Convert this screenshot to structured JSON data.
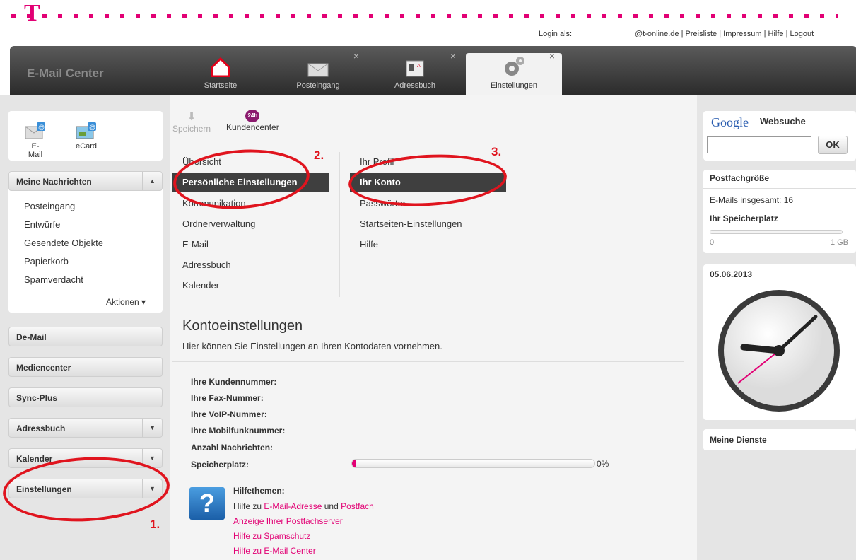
{
  "header": {
    "login_label": "Login als:",
    "account": "@t-online.de",
    "links": [
      "Preisliste",
      "Impressum",
      "Hilfe",
      "Logout"
    ],
    "app_name": "E-Mail Center"
  },
  "tabs": [
    {
      "label": "Startseite"
    },
    {
      "label": "Posteingang",
      "close": "×"
    },
    {
      "label": "Adressbuch",
      "close": "×"
    },
    {
      "label": "Einstellungen",
      "close": "×"
    }
  ],
  "quick": {
    "email": "E-Mail",
    "ecard": "eCard"
  },
  "nachrichten": {
    "title": "Meine Nachrichten",
    "items": [
      "Posteingang",
      "Entwürfe",
      "Gesendete Objekte",
      "Papierkorb",
      "Spamverdacht"
    ],
    "aktionen": "Aktionen"
  },
  "sections": [
    "De-Mail",
    "Mediencenter",
    "Sync-Plus",
    "Adressbuch",
    "Kalender",
    "Einstellungen"
  ],
  "toolbar": {
    "save": "Speichern",
    "kundencenter": "Kundencenter",
    "badge": "24h"
  },
  "menu1": [
    "Übersicht",
    "Persönliche Einstellungen",
    "Kommunikation",
    "Ordnerverwaltung",
    "E-Mail",
    "Adressbuch",
    "Kalender"
  ],
  "menu2": [
    "Ihr Profil",
    "Ihr Konto",
    "Passwörter",
    "Startseiten-Einstellungen",
    "Hilfe"
  ],
  "konto": {
    "title": "Kontoeinstellungen",
    "desc": "Hier können Sie Einstellungen an Ihren Kontodaten vornehmen.",
    "fields": [
      "Ihre Kundennummer:",
      "Ihre Fax-Nummer:",
      "Ihre VoIP-Nummer:",
      "Ihre Mobilfunknummer:",
      "Anzahl Nachrichten:",
      "Speicherplatz:"
    ],
    "storage_pct": "0%",
    "storage_fraction": 0.0
  },
  "help": {
    "title": "Hilfethemen:",
    "line1_prefix": "Hilfe zu ",
    "line1_link1": "E-Mail-Adresse",
    "line1_mid": " und ",
    "line1_link2": "Postfach",
    "links": [
      "Anzeige Ihrer Postfachserver",
      "Hilfe zu Spamschutz",
      "Hilfe zu E-Mail Center"
    ]
  },
  "google": {
    "logo": "Google",
    "label": "Websuche",
    "button": "OK"
  },
  "postfach": {
    "title": "Postfachgröße",
    "count": "E-Mails insgesamt: 16",
    "speicher": "Ihr Speicherplatz",
    "min": "0",
    "max": "1 GB"
  },
  "clock": {
    "date": "05.06.2013"
  },
  "dienste": {
    "title": "Meine Dienste"
  },
  "annotations": {
    "n1": "1.",
    "n2": "2.",
    "n3": "3."
  },
  "colors": {
    "brand": "#e20074",
    "annotation": "#e0141e",
    "header": "#3a3a3a"
  }
}
